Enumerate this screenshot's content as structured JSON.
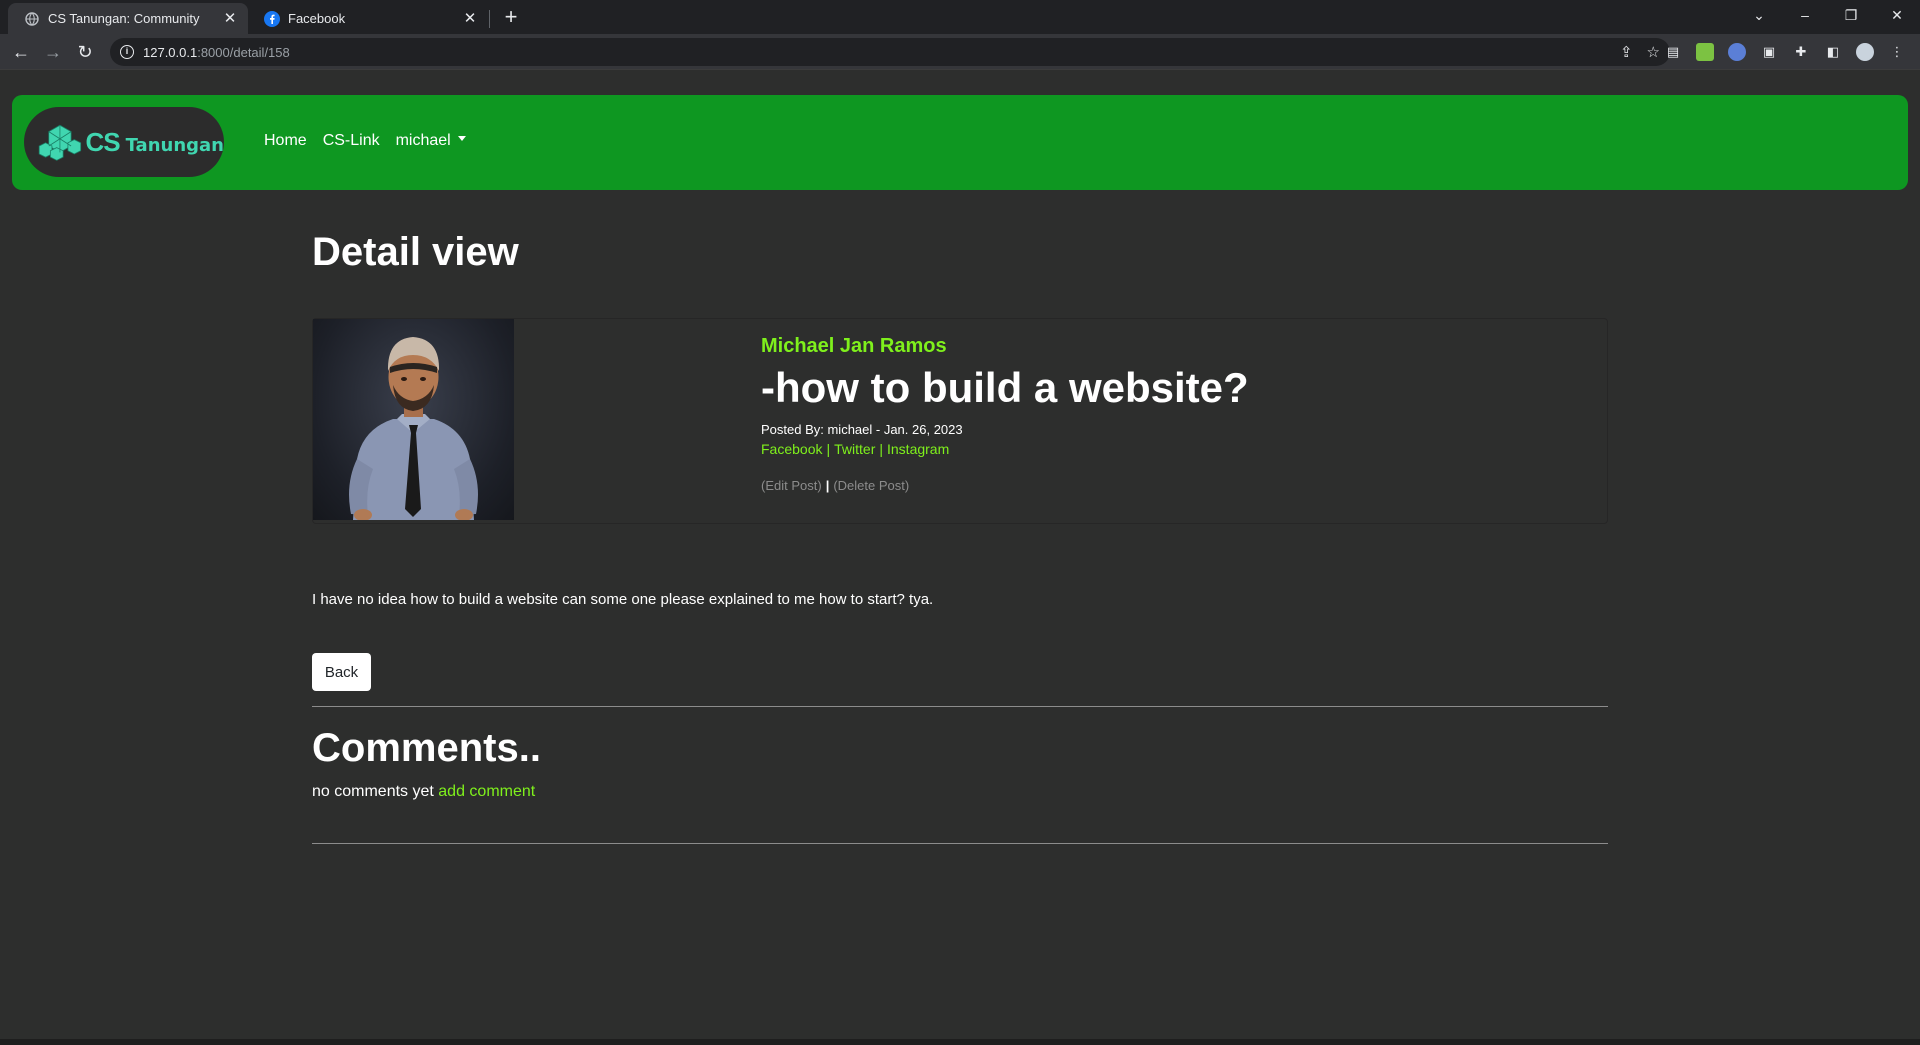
{
  "browser": {
    "tabs": [
      {
        "title": "CS Tanungan: Community",
        "favicon": "globe-icon",
        "active": true
      },
      {
        "title": "Facebook",
        "favicon": "facebook-icon",
        "active": false
      }
    ],
    "url": {
      "host": "127.0.0.1",
      "path": ":8000/detail/158"
    }
  },
  "navbar": {
    "brand": {
      "cs": "CS",
      "name": "Tanungan"
    },
    "links": {
      "home": "Home",
      "cslink": "CS-Link",
      "user": "michael"
    },
    "color": "#0e9721"
  },
  "page": {
    "title": "Detail view"
  },
  "post": {
    "author": "Michael Jan Ramos",
    "title": "-how to build a website?",
    "meta": "Posted By: michael - Jan. 26, 2023",
    "socials": {
      "facebook": "Facebook",
      "twitter": "Twitter",
      "instagram": "Instagram",
      "separator": "|"
    },
    "actions": {
      "edit": "(Edit Post)",
      "divider": "|",
      "delete": "(Delete Post)"
    },
    "body": "I have no idea how to build a website can some one please explained to me how to start? tya."
  },
  "back_label": "Back",
  "comments": {
    "title": "Comments..",
    "empty": "no comments yet",
    "add": "add comment"
  },
  "colors": {
    "accent": "#7ff01c",
    "background": "#2d2e2d"
  }
}
